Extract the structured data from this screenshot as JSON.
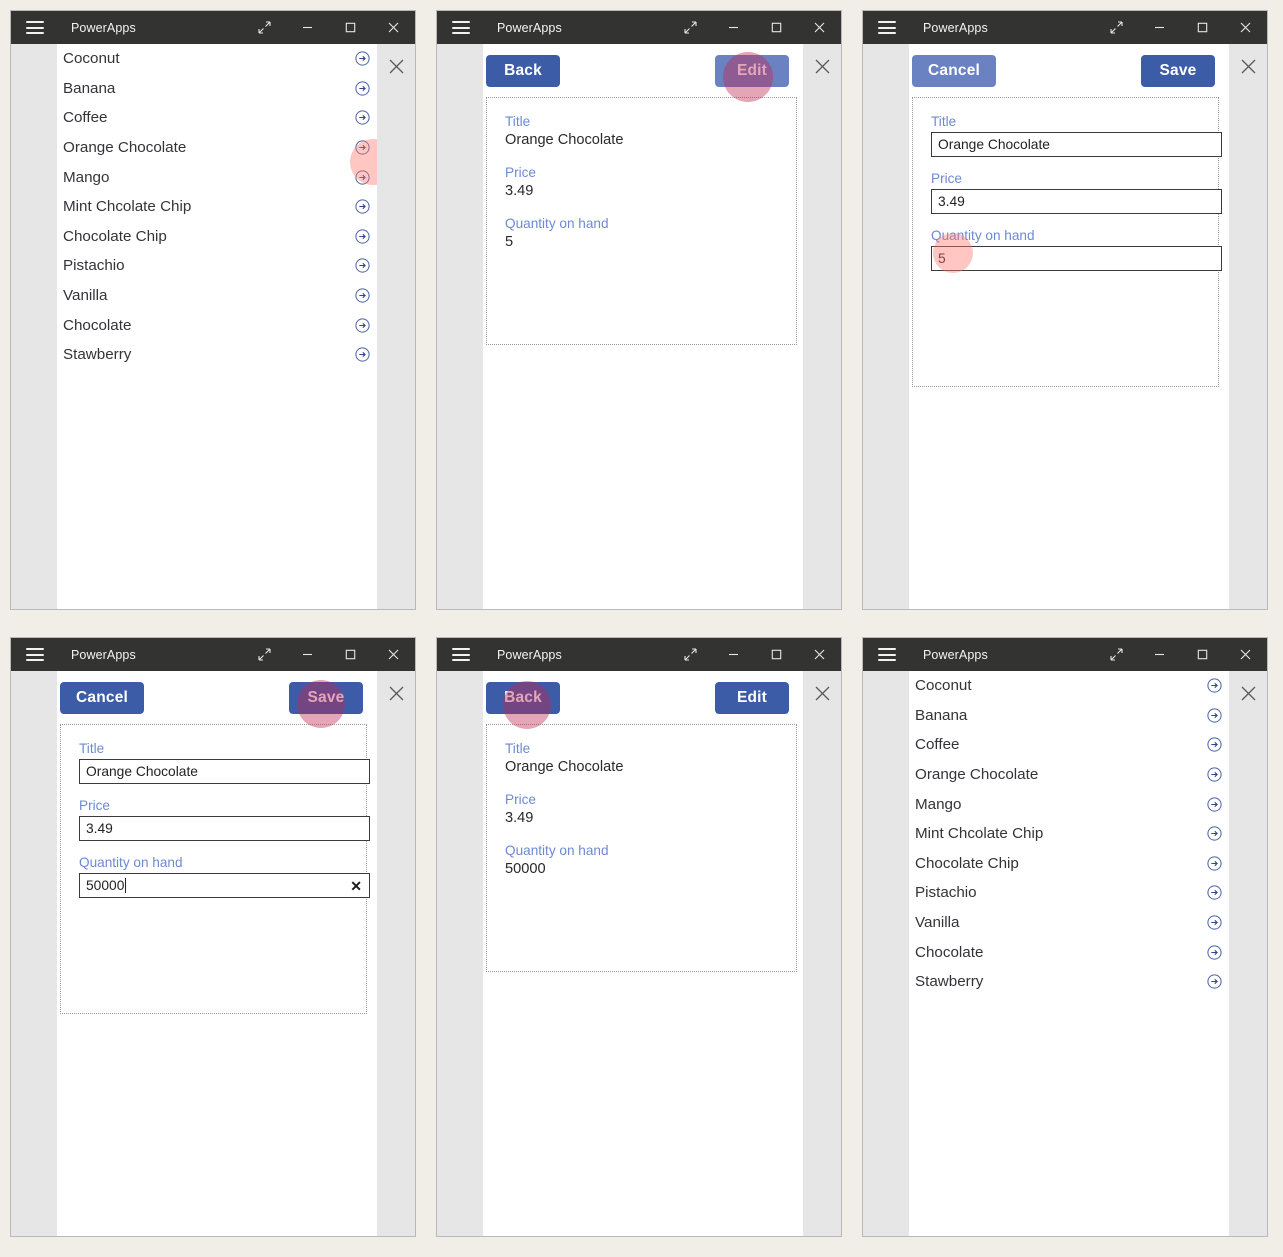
{
  "window": {
    "title": "PowerApps",
    "controls": {
      "menu": "hamburger-menu",
      "expand": "expand-arrows",
      "minimize": "minimize",
      "maximize": "maximize",
      "close": "close"
    },
    "rail_close": "×"
  },
  "colors": {
    "page_background": "#f0eee6",
    "titlebar": "#333332",
    "app_chrome": "#e6e6e6",
    "screen": "#ffffff",
    "button_primary": "#3d5ca8",
    "button_secondary": "#6b82c2",
    "field_label": "#6c8ad4",
    "chevron": "#4a62a8",
    "highlight_light": "rgba(255,120,110,0.42)",
    "highlight_dark": "rgba(190,40,80,0.42)"
  },
  "list": {
    "items": [
      {
        "label": "Coconut"
      },
      {
        "label": "Banana"
      },
      {
        "label": "Coffee"
      },
      {
        "label": "Orange Chocolate"
      },
      {
        "label": "Mango"
      },
      {
        "label": "Mint Chcolate Chip"
      },
      {
        "label": "Chocolate Chip"
      },
      {
        "label": "Pistachio"
      },
      {
        "label": "Vanilla"
      },
      {
        "label": "Chocolate"
      },
      {
        "label": "Stawberry"
      }
    ]
  },
  "form_labels": {
    "title": "Title",
    "price": "Price",
    "quantity": "Quantity on hand"
  },
  "buttons": {
    "back": "Back",
    "edit": "Edit",
    "cancel": "Cancel",
    "save": "Save"
  },
  "panels": [
    {
      "id": "panel-1-list-before",
      "type": "list",
      "highlight": {
        "target": "chevron-row-4",
        "style": "light"
      }
    },
    {
      "id": "panel-2-detail-before",
      "type": "detail",
      "record": {
        "title": "Orange Chocolate",
        "price": "3.49",
        "quantity": "5"
      },
      "left_button": "Back",
      "right_button": "Edit",
      "left_style": "dark",
      "right_style": "light",
      "highlight": {
        "target": "edit-button",
        "style": "dark"
      }
    },
    {
      "id": "panel-3-edit-before",
      "type": "edit",
      "record": {
        "title": "Orange Chocolate",
        "price": "3.49",
        "quantity": "5"
      },
      "left_button": "Cancel",
      "right_button": "Save",
      "left_style": "light",
      "right_style": "dark",
      "show_clear": false,
      "highlight": {
        "target": "quantity-field",
        "style": "light"
      }
    },
    {
      "id": "panel-4-edit-after",
      "type": "edit",
      "record": {
        "title": "Orange Chocolate",
        "price": "3.49",
        "quantity": "50000"
      },
      "left_button": "Cancel",
      "right_button": "Save",
      "left_style": "dark",
      "right_style": "dark",
      "show_clear": true,
      "highlight": {
        "target": "save-button",
        "style": "dark"
      }
    },
    {
      "id": "panel-5-detail-after",
      "type": "detail",
      "record": {
        "title": "Orange Chocolate",
        "price": "3.49",
        "quantity": "50000"
      },
      "left_button": "Back",
      "right_button": "Edit",
      "left_style": "dark",
      "right_style": "dark",
      "highlight": {
        "target": "back-button",
        "style": "dark"
      }
    },
    {
      "id": "panel-6-list-after",
      "type": "list",
      "highlight": null
    }
  ]
}
